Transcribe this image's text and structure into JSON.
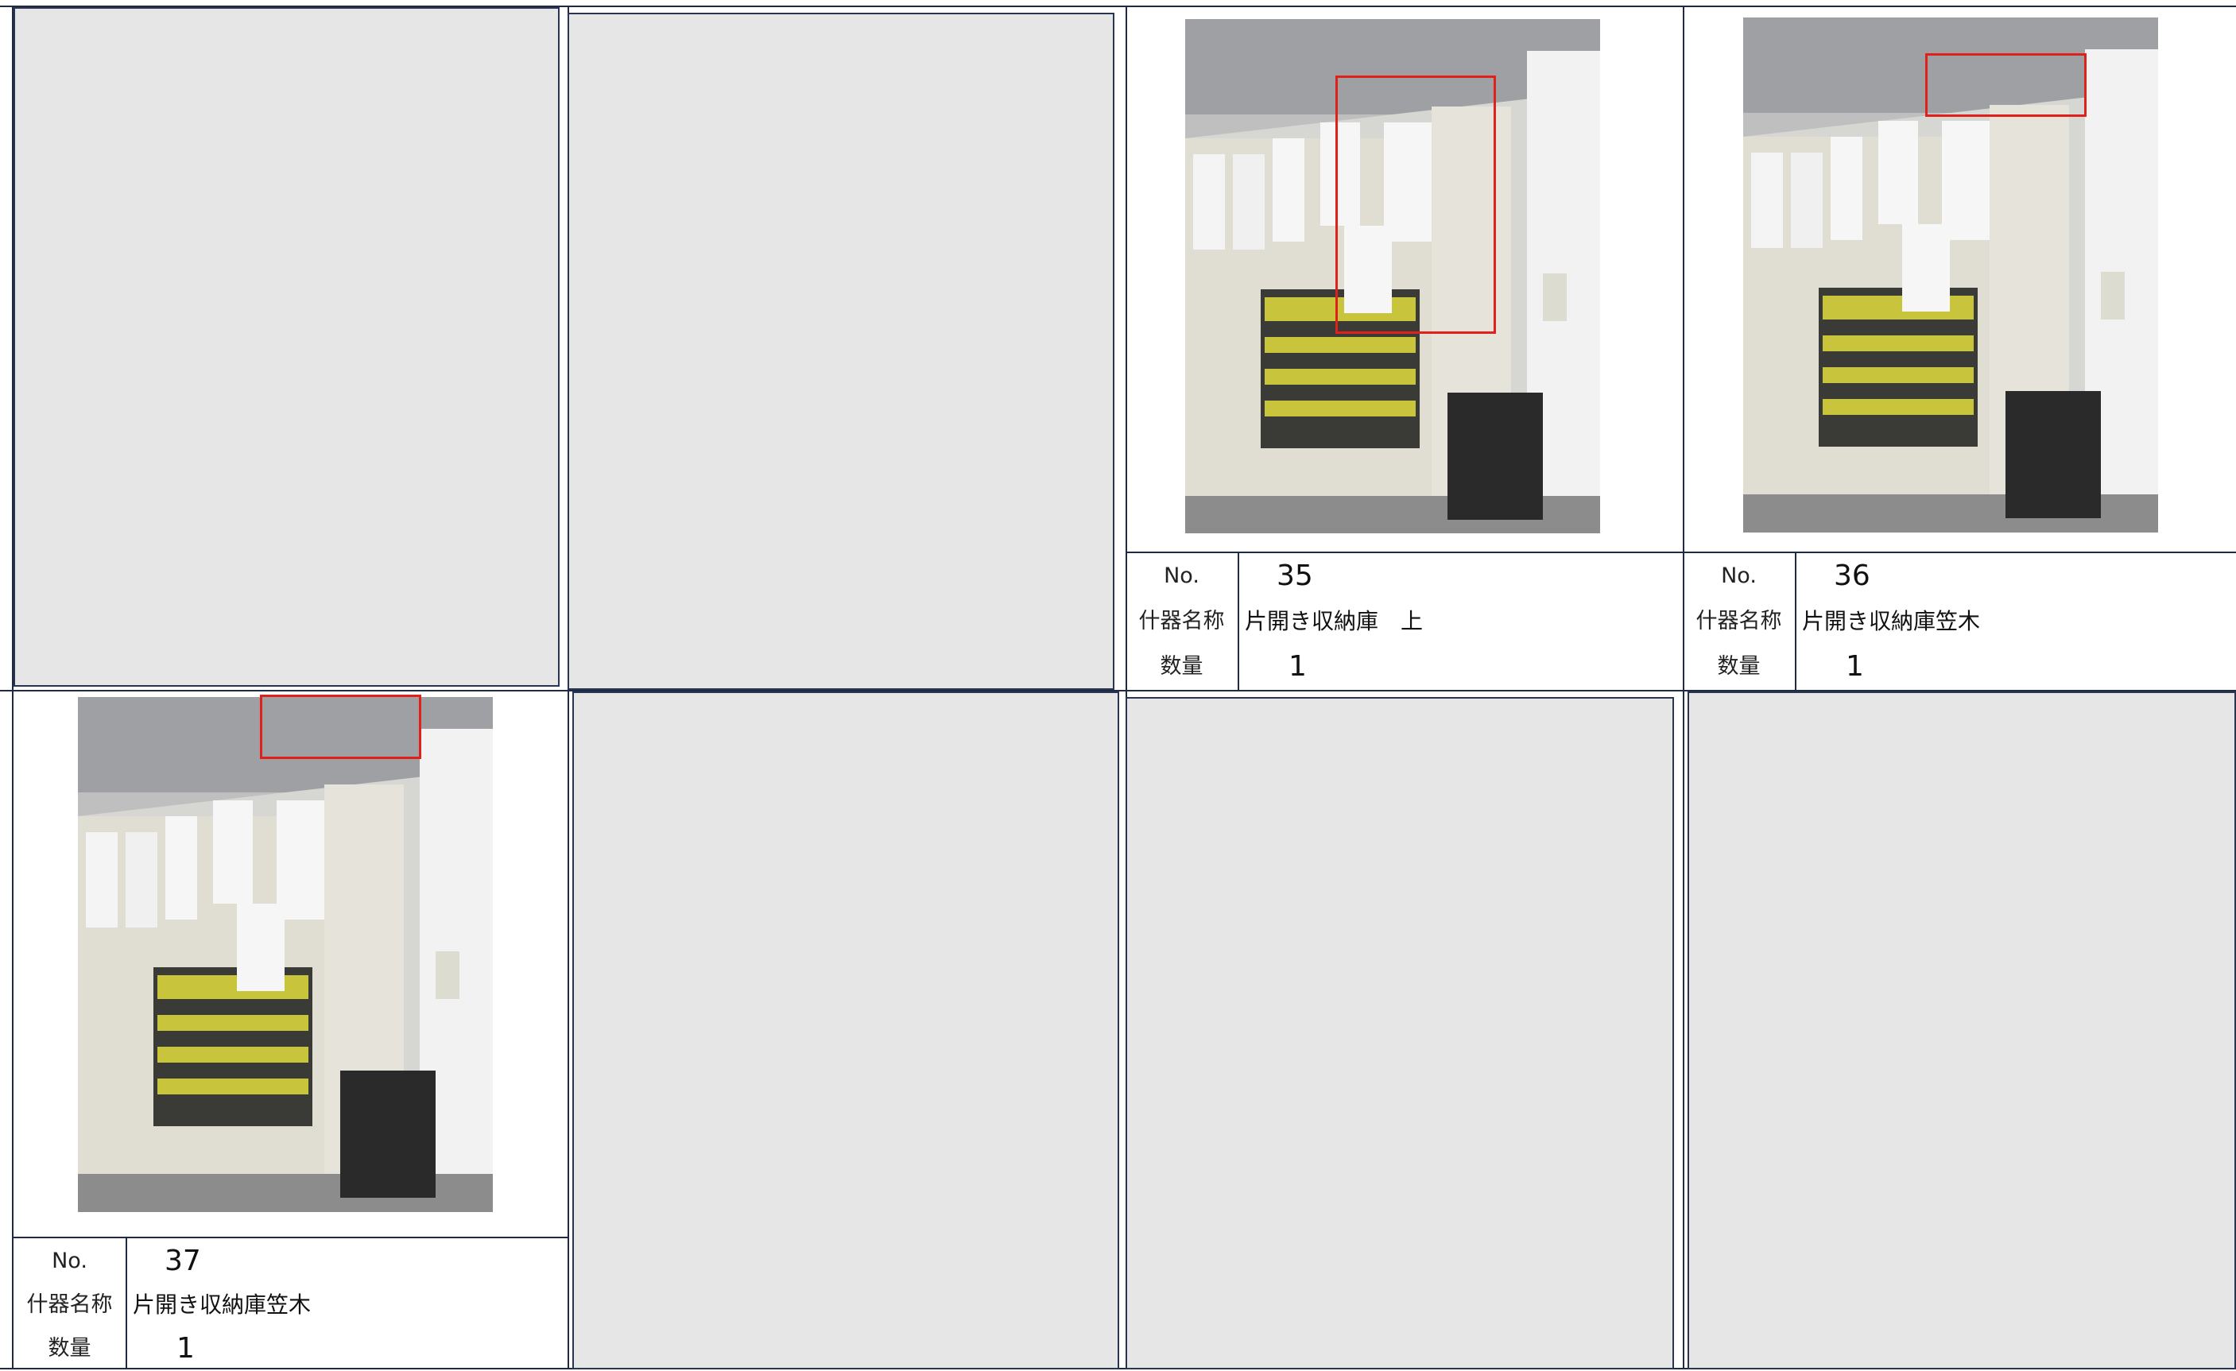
{
  "labels": {
    "no": "No.",
    "name": "什器名称",
    "qty": "数量"
  },
  "cards": [
    {
      "no": "35",
      "name": "片開き収納庫　上",
      "qty": "1"
    },
    {
      "no": "36",
      "name": "片開き収納庫笠木",
      "qty": "1"
    },
    {
      "no": "37",
      "name": "片開き収納庫笠木",
      "qty": "1"
    }
  ],
  "colors": {
    "grid": "#1f2a44",
    "highlight": "#e0201b",
    "placeholder": "#e6e6e6"
  }
}
